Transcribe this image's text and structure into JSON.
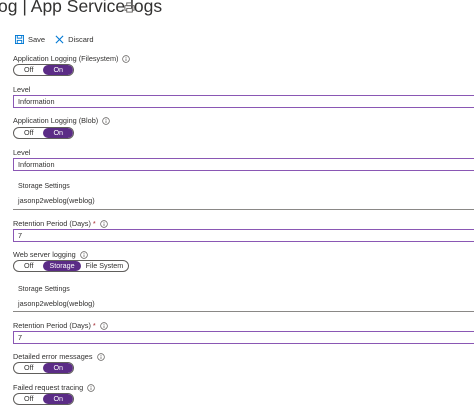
{
  "header": {
    "title": "og | App Service logs",
    "print_icon": "print-icon"
  },
  "toolbar": {
    "save_label": "Save",
    "discard_label": "Discard",
    "save_icon": "save-icon",
    "discard_icon": "close-icon"
  },
  "app_logging_fs": {
    "label": "Application Logging (Filesystem)",
    "off": "Off",
    "on": "On",
    "selected": "On"
  },
  "level_fs": {
    "label": "Level",
    "value": "Information"
  },
  "app_logging_blob": {
    "label": "Application Logging (Blob)",
    "off": "Off",
    "on": "On",
    "selected": "On"
  },
  "level_blob": {
    "label": "Level",
    "value": "Information"
  },
  "storage_blob": {
    "label": "Storage Settings",
    "value": "jasonp2weblog(weblog)"
  },
  "retention_blob": {
    "label": "Retention Period (Days)",
    "required": "*",
    "value": "7"
  },
  "web_server_logging": {
    "label": "Web server logging",
    "off": "Off",
    "storage": "Storage",
    "filesystem": "File System",
    "selected": "Storage"
  },
  "storage_web": {
    "label": "Storage Settings",
    "value": "jasonp2weblog(weblog)"
  },
  "retention_web": {
    "label": "Retention Period (Days)",
    "required": "*",
    "value": "7"
  },
  "detailed_errors": {
    "label": "Detailed error messages",
    "off": "Off",
    "on": "On",
    "selected": "On"
  },
  "failed_request": {
    "label": "Failed request tracing",
    "off": "Off",
    "on": "On",
    "selected": "On"
  },
  "colors": {
    "accent": "#5b2c86",
    "field_border": "#8a57b4",
    "toolbar_icon": "#0078d4",
    "required": "#a4262c"
  }
}
